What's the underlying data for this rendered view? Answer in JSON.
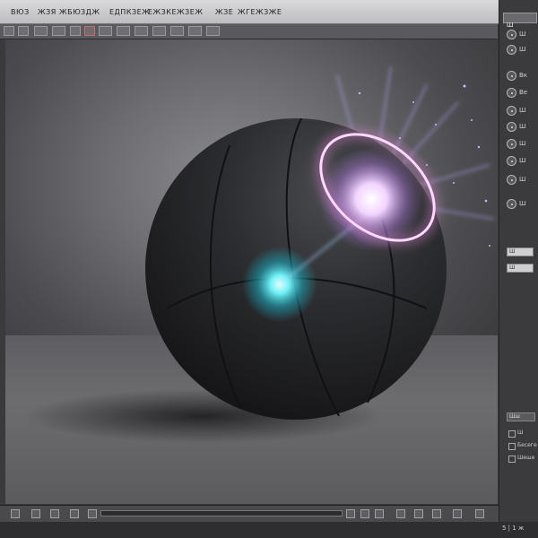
{
  "menubar": {
    "items": [
      "ВЮЗ",
      "ЖЗЯ",
      "ЖБЮ",
      "ЗДЖ",
      "ЕДПКЗЕЖ",
      "ЕЖЗКЕЖЗЕЖ",
      "ЖЗЕ",
      "ЖГЕЖЗЖЕ"
    ]
  },
  "right_panel": {
    "top_label": "Ш",
    "rows": [
      "Ш",
      "Ш",
      "Вк",
      "Ве",
      "Ш",
      "Ш",
      "Ш",
      "Ш",
      "Ш",
      "Ш"
    ],
    "fields": [
      "Ш",
      "Ш"
    ],
    "lower_labels": [
      "Шш",
      "Ш",
      "Бесеге",
      "Шеше"
    ]
  },
  "bottom": {
    "readout": "5 | 1 ж"
  },
  "colors": {
    "viewport_bg": "#6e6e72",
    "sphere": "#2b2c2f",
    "ring_glow": "#e08ad8",
    "core_glow": "#4fe3ef"
  },
  "icons": {
    "render_object": "sphere-object",
    "light_ring": "ring-light-icon",
    "core_light": "point-light-icon"
  }
}
